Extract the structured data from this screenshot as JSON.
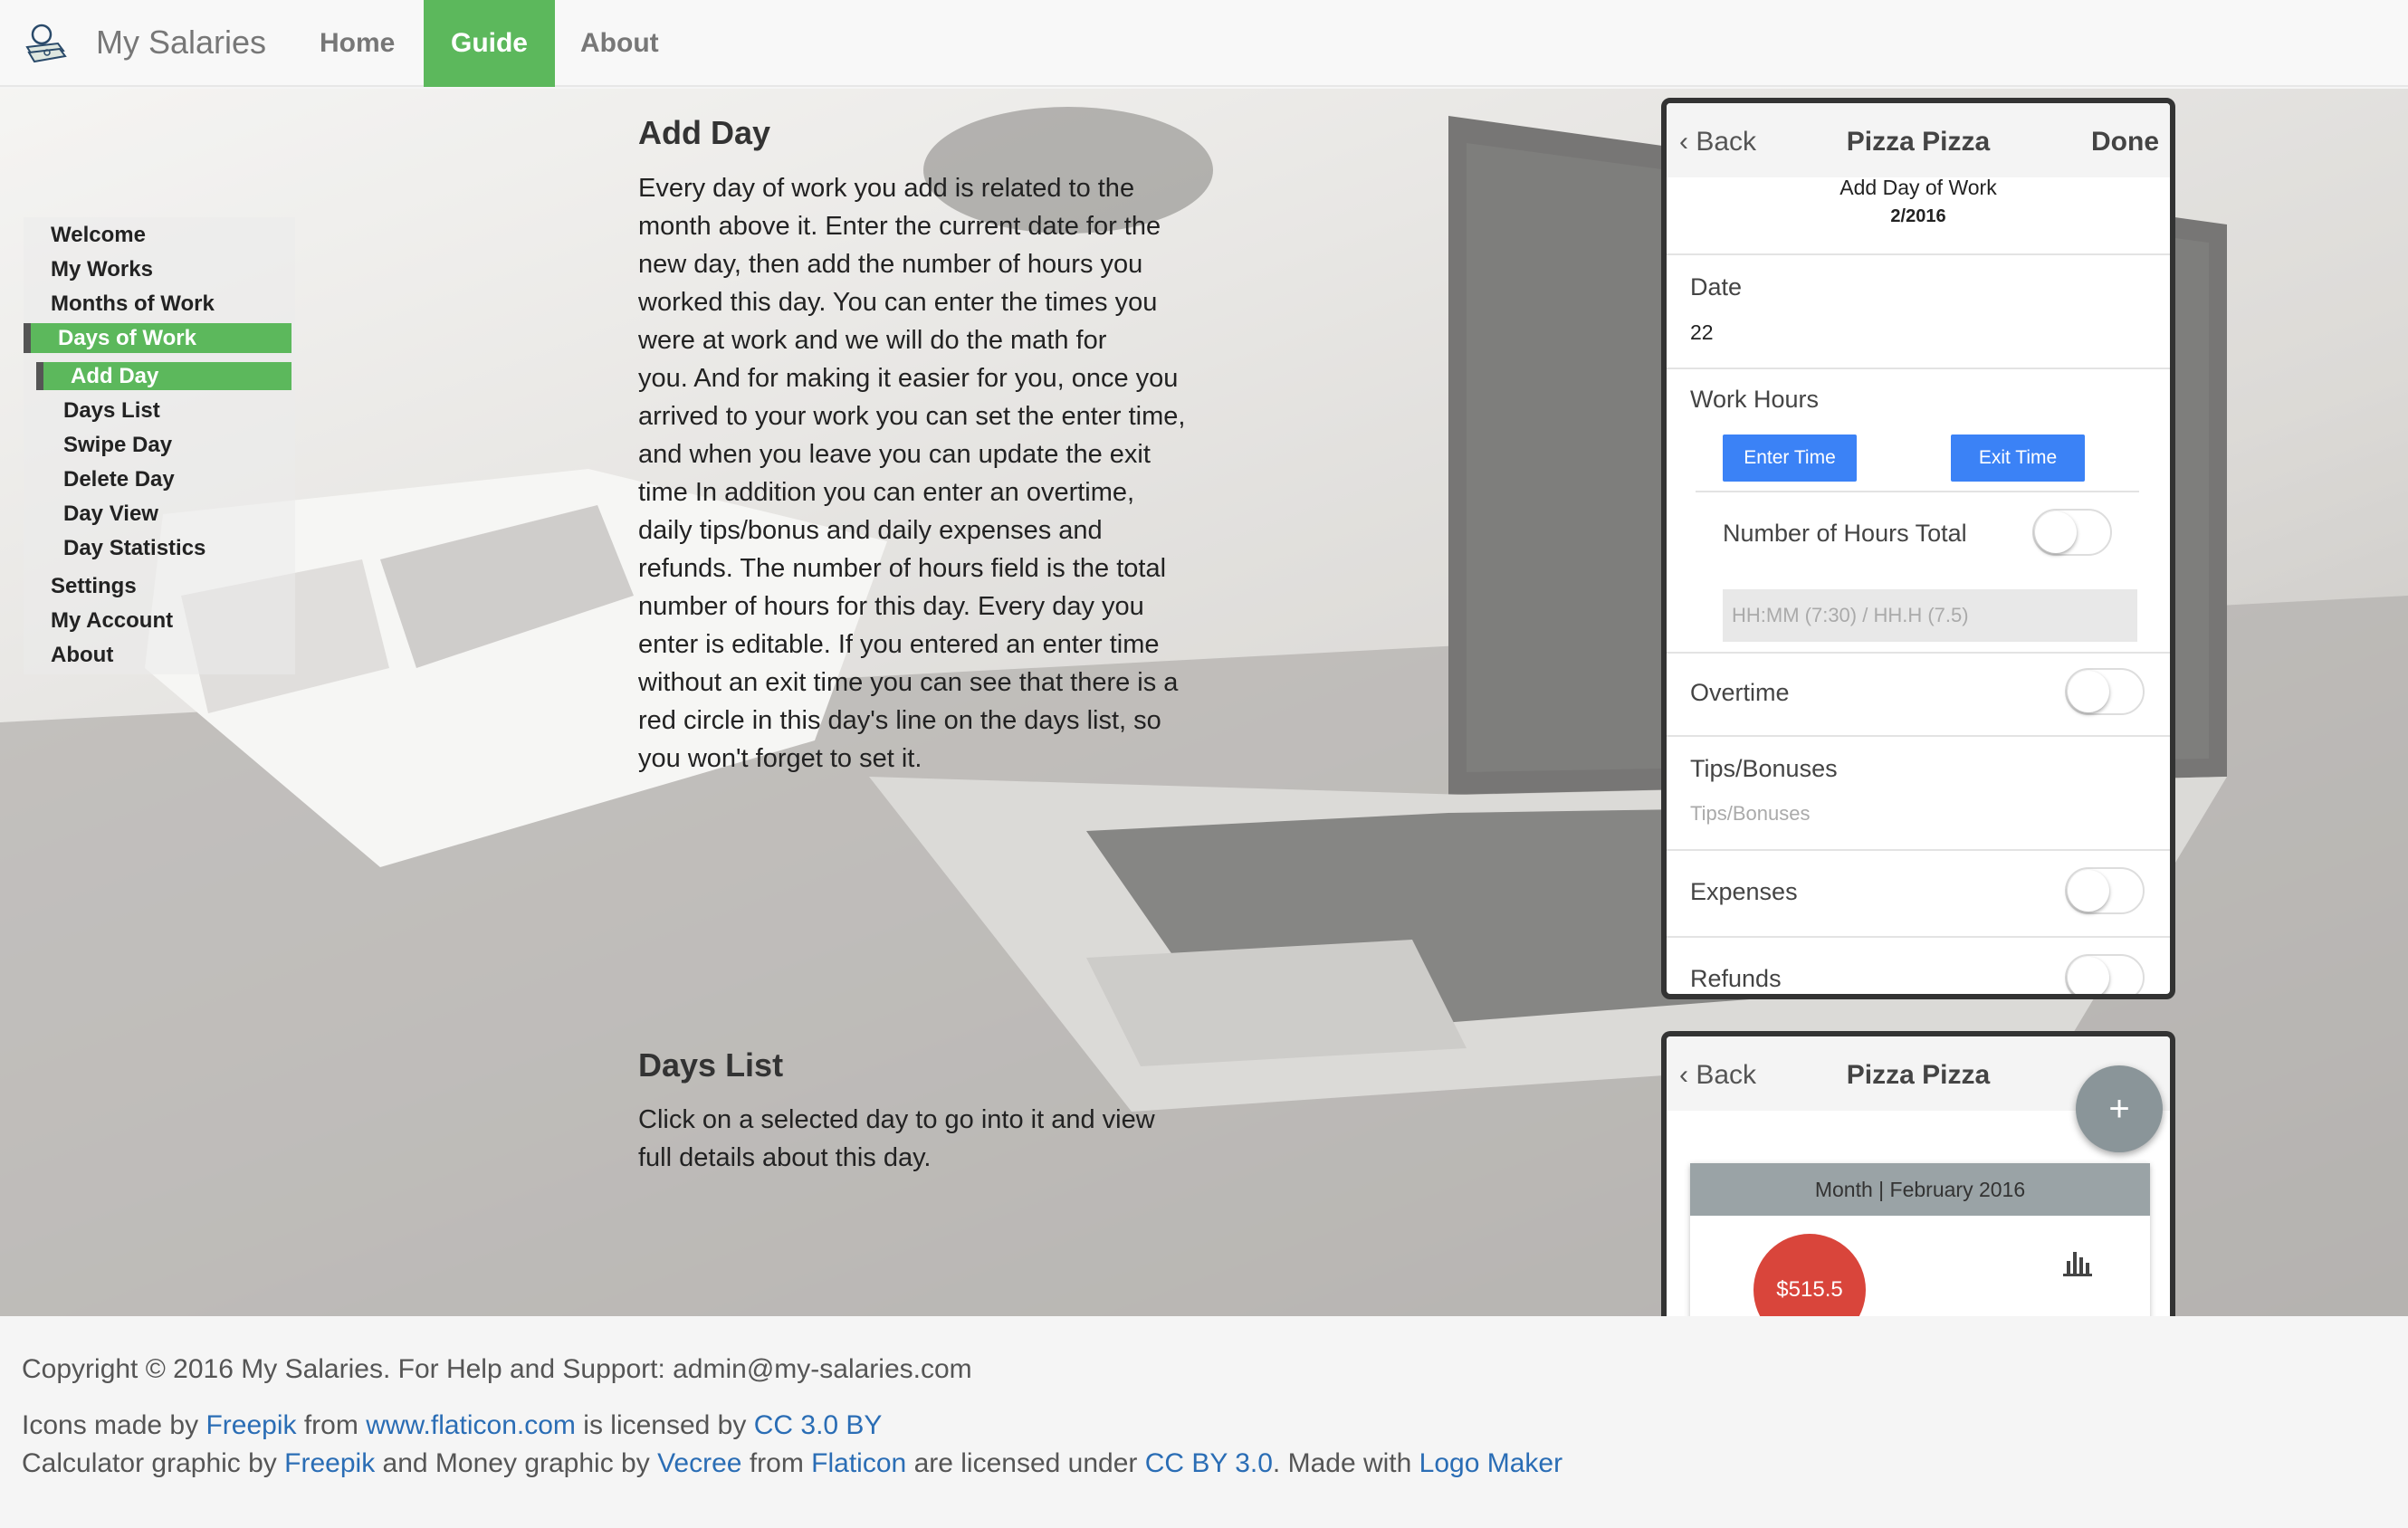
{
  "navbar": {
    "brand": "My Salaries",
    "items": [
      {
        "label": "Home"
      },
      {
        "label": "Guide"
      },
      {
        "label": "About"
      }
    ]
  },
  "sidebar": {
    "items": [
      {
        "label": "Welcome"
      },
      {
        "label": "My Works"
      },
      {
        "label": "Months of Work"
      },
      {
        "label": "Days of Work"
      },
      {
        "label": "Add Day"
      },
      {
        "label": "Days List"
      },
      {
        "label": "Swipe Day"
      },
      {
        "label": "Delete Day"
      },
      {
        "label": "Day View"
      },
      {
        "label": "Day Statistics"
      },
      {
        "label": "Settings"
      },
      {
        "label": "My Account"
      },
      {
        "label": "About"
      }
    ]
  },
  "content": {
    "add_day": {
      "title": "Add Day",
      "lines": [
        "Every day of work you add is related to the",
        "month above it. Enter the current date for the",
        "new day, then add the number of hours you",
        "worked this day. You can enter the times you",
        "were at work and we will do the math for",
        "you. And for making it easier for you, once you",
        "arrived to your work you can set the enter time,",
        "and when you leave you can update the exit",
        "time In addition you can enter an overtime,",
        "daily tips/bonus and daily expenses and",
        "refunds. The number of hours field is the total",
        "number of hours for this day. Every day you",
        "enter is editable. If you entered an enter time",
        "without an exit time you can see that there is a",
        "red circle in this day's line on the days list, so",
        "you won't forget to set it."
      ]
    },
    "days_list": {
      "title": "Days List",
      "lines": [
        "Click on a selected day to go into it and view",
        "full details about this day."
      ]
    }
  },
  "phone1": {
    "back": "Back",
    "title": "Pizza Pizza",
    "done": "Done",
    "subtitle": "Add Day of Work",
    "period": "2/2016",
    "date_label": "Date",
    "date_value": "22",
    "work_hours_label": "Work Hours",
    "enter_time": "Enter Time",
    "exit_time": "Exit Time",
    "hours_total_label": "Number of Hours Total",
    "hours_placeholder": "HH:MM (7:30) / HH.H (7.5)",
    "overtime_label": "Overtime",
    "tips_label": "Tips/Bonuses",
    "tips_placeholder": "Tips/Bonuses",
    "expenses_label": "Expenses",
    "refunds_label": "Refunds"
  },
  "phone2": {
    "back": "Back",
    "title": "Pizza Pizza",
    "fab": "+",
    "month_header": "Month | February 2016",
    "amount": "$515.5"
  },
  "footer": {
    "copyright": "Copyright © 2016 My Salaries. For Help and Support: admin@my-salaries.com",
    "icons_prefix": "Icons made by",
    "icons_author": "Freepik",
    "icons_from": "from",
    "icons_site": "www.flaticon.com",
    "icons_licensed": "is licensed by",
    "icons_license": "CC 3.0 BY",
    "calc_prefix": "Calculator graphic by",
    "calc_author": "Freepik",
    "calc_and": "and Money graphic by",
    "money_author": "Vecree",
    "calc_from": "from",
    "calc_site": "Flaticon",
    "calc_licensed": "are licensed under",
    "calc_license": "CC BY 3.0",
    "made_with": ". Made with",
    "logo_maker": "Logo Maker"
  },
  "colors": {
    "accent": "#5cb85c",
    "link": "#2a6db5",
    "button": "#3b82f6",
    "money_circle": "#d9453b"
  }
}
